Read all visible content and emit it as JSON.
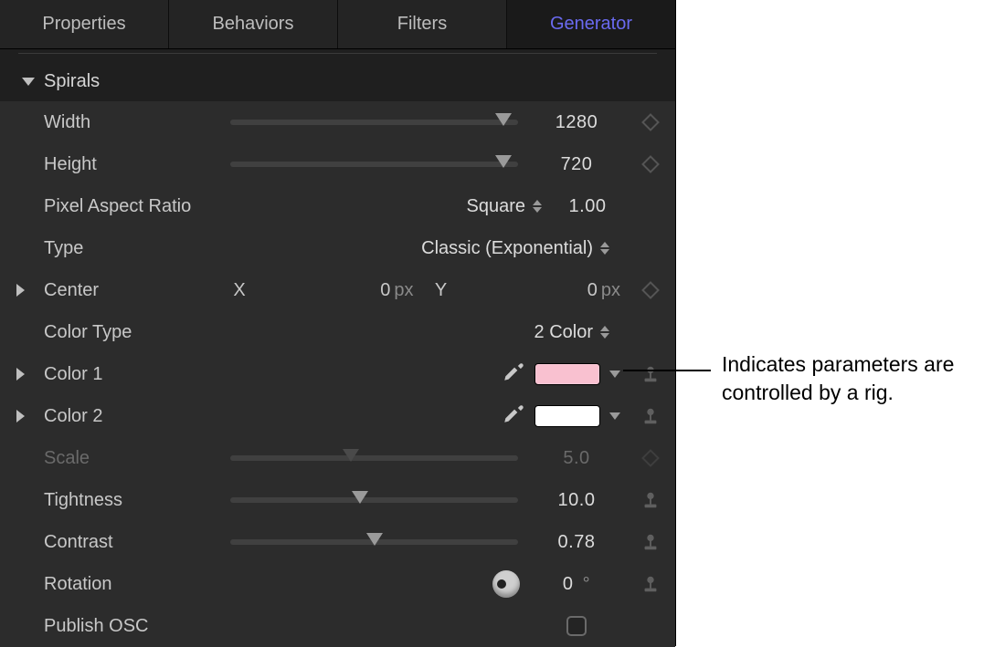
{
  "tabs": {
    "properties": "Properties",
    "behaviors": "Behaviors",
    "filters": "Filters",
    "generator": "Generator"
  },
  "section": {
    "title": "Spirals"
  },
  "params": {
    "width": {
      "label": "Width",
      "value": "1280",
      "slider_pct": 95
    },
    "height": {
      "label": "Height",
      "value": "720",
      "slider_pct": 95
    },
    "pixelAspect": {
      "label": "Pixel Aspect Ratio",
      "menu": "Square",
      "value": "1.00"
    },
    "type": {
      "label": "Type",
      "menu": "Classic (Exponential)"
    },
    "center": {
      "label": "Center",
      "xLabel": "X",
      "x": "0",
      "xUnit": "px",
      "yLabel": "Y",
      "y": "0",
      "yUnit": "px"
    },
    "colorType": {
      "label": "Color Type",
      "menu": "2 Color"
    },
    "color1": {
      "label": "Color 1",
      "hex": "#f9c1d0"
    },
    "color2": {
      "label": "Color 2",
      "hex": "#ffffff"
    },
    "scale": {
      "label": "Scale",
      "value": "5.0",
      "slider_pct": 42
    },
    "tightness": {
      "label": "Tightness",
      "value": "10.0",
      "slider_pct": 45
    },
    "contrast": {
      "label": "Contrast",
      "value": "0.78",
      "slider_pct": 50
    },
    "rotation": {
      "label": "Rotation",
      "value": "0",
      "unit": "°"
    },
    "publishOSC": {
      "label": "Publish OSC"
    }
  },
  "callout": "Indicates parameters are controlled by a rig."
}
